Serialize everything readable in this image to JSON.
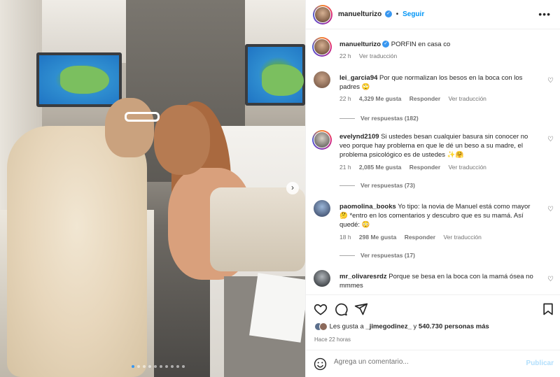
{
  "post": {
    "carousel_index": 1,
    "carousel_total": 10
  },
  "header": {
    "username": "manuelturizo",
    "verified": true,
    "follow_label": "Seguir",
    "more_icon": "ellipsis-icon"
  },
  "caption": {
    "username": "manuelturizo",
    "text": "PORFIN en casa co",
    "time": "22 h",
    "translate": "Ver traducción"
  },
  "comments": [
    {
      "username": "lei_garcia94",
      "text": "Por que normalizan los besos en la boca con los padres 🙄",
      "time": "22 h",
      "likes": "4,329 Me gusta",
      "reply": "Responder",
      "translate": "Ver traducción",
      "replies": "Ver respuestas (182)"
    },
    {
      "username": "evelynd2109",
      "text": "Si ustedes besan cualquier basura sin conocer no veo porque hay problema en que le dé un beso a su madre, el problema psicológico es de ustedes ✨🤗",
      "time": "21 h",
      "likes": "2,085 Me gusta",
      "reply": "Responder",
      "translate": "Ver traducción",
      "replies": "Ver respuestas (73)"
    },
    {
      "username": "paomolina_books",
      "text": "Yo tipo: la novia de Manuel está como mayor 🤔 *entro en los comentarios y descubro que es su mamá. Así quedé: 😳",
      "time": "18 h",
      "likes": "298 Me gusta",
      "reply": "Responder",
      "translate": "Ver traducción",
      "replies": "Ver respuestas (17)"
    },
    {
      "username": "mr_olivaresrdz",
      "text": "Porque se besa en la boca con la mamá ósea no mmmes"
    }
  ],
  "likes": {
    "prefix": "Les gusta a ",
    "user": "_jimegodinez_",
    "middle": " y ",
    "count": "540.730 personas más"
  },
  "time_ago": "Hace 22 horas",
  "add_comment": {
    "placeholder": "Agrega un comentario...",
    "publish": "Publicar"
  },
  "colors": {
    "accent": "#0095f6",
    "verified": "#3897f0",
    "muted": "#737373"
  }
}
